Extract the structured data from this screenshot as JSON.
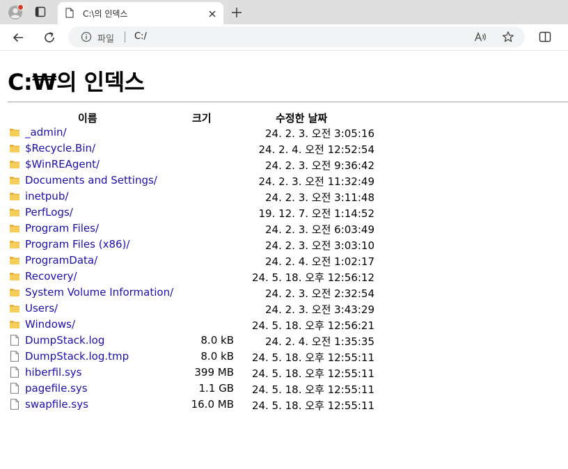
{
  "browser": {
    "tab_title": "C:\\의 인덱스",
    "address_scheme": "파일",
    "address_url": "C:/"
  },
  "page": {
    "title": "C:₩의 인덱스",
    "headers": {
      "name": "이름",
      "size": "크기",
      "modified": "수정한 날짜"
    },
    "entries": [
      {
        "type": "folder",
        "name": "_admin/",
        "size": "",
        "date": "24. 2. 3. 오전 3:05:16"
      },
      {
        "type": "folder",
        "name": "$Recycle.Bin/",
        "size": "",
        "date": "24. 2. 4. 오전 12:52:54"
      },
      {
        "type": "folder",
        "name": "$WinREAgent/",
        "size": "",
        "date": "24. 2. 3. 오전 9:36:42"
      },
      {
        "type": "folder",
        "name": "Documents and Settings/",
        "size": "",
        "date": "24. 2. 3. 오전 11:32:49"
      },
      {
        "type": "folder",
        "name": "inetpub/",
        "size": "",
        "date": "24. 2. 3. 오전 3:11:48"
      },
      {
        "type": "folder",
        "name": "PerfLogs/",
        "size": "",
        "date": "19. 12. 7. 오전 1:14:52"
      },
      {
        "type": "folder",
        "name": "Program Files/",
        "size": "",
        "date": "24. 2. 3. 오전 6:03:49"
      },
      {
        "type": "folder",
        "name": "Program Files (x86)/",
        "size": "",
        "date": "24. 2. 3. 오전 3:03:10"
      },
      {
        "type": "folder",
        "name": "ProgramData/",
        "size": "",
        "date": "24. 2. 4. 오전 1:02:17"
      },
      {
        "type": "folder",
        "name": "Recovery/",
        "size": "",
        "date": "24. 5. 18. 오후 12:56:12"
      },
      {
        "type": "folder",
        "name": "System Volume Information/",
        "size": "",
        "date": "24. 2. 3. 오전 2:32:54"
      },
      {
        "type": "folder",
        "name": "Users/",
        "size": "",
        "date": "24. 2. 3. 오전 3:43:29"
      },
      {
        "type": "folder",
        "name": "Windows/",
        "size": "",
        "date": "24. 5. 18. 오후 12:56:21"
      },
      {
        "type": "file",
        "name": "DumpStack.log",
        "size": "8.0 kB",
        "date": "24. 2. 4. 오전 1:35:35"
      },
      {
        "type": "file",
        "name": "DumpStack.log.tmp",
        "size": "8.0 kB",
        "date": "24. 5. 18. 오후 12:55:11"
      },
      {
        "type": "file",
        "name": "hiberfil.sys",
        "size": "399 MB",
        "date": "24. 5. 18. 오후 12:55:11"
      },
      {
        "type": "file",
        "name": "pagefile.sys",
        "size": "1.1 GB",
        "date": "24. 5. 18. 오후 12:55:11"
      },
      {
        "type": "file",
        "name": "swapfile.sys",
        "size": "16.0 MB",
        "date": "24. 5. 18. 오후 12:55:11"
      }
    ]
  },
  "colors": {
    "link": "#1a0dab",
    "folder": "#f4c542",
    "titlebar": "#dfdfdf"
  }
}
